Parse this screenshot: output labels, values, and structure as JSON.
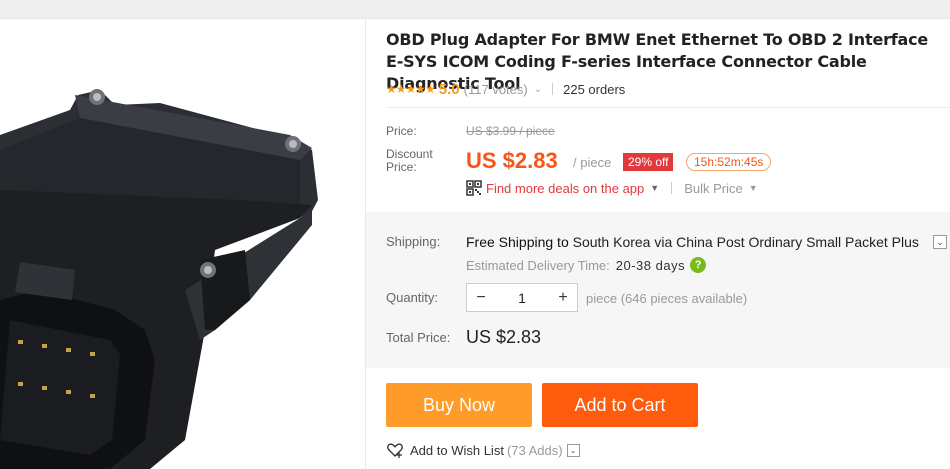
{
  "product": {
    "title": "OBD Plug Adapter For BMW Enet Ethernet To OBD 2 Interface E-SYS ICOM Coding F-series Interface Connector Cable Diagnostic Tool",
    "image_alt": "OBD connector adapter"
  },
  "rating": {
    "stars": "★★★★★",
    "value": "5.0",
    "votes": "(117 votes)",
    "orders": "225 orders"
  },
  "price": {
    "price_label": "Price:",
    "old_price": "US $3.99 / piece",
    "discount_label_line1": "Discount",
    "discount_label_line2": "Price:",
    "current": "US $2.83",
    "unit": "/ piece",
    "discount_badge": "29% off",
    "timer": "15h:52m:45s",
    "app_deals": "Find more deals on the app",
    "bulk_price": "Bulk Price"
  },
  "shipping": {
    "label": "Shipping:",
    "method_prefix": "Free Shipping to",
    "method_rest": "South Korea via China Post Ordinary Small Packet Plus",
    "delivery_label": "Estimated Delivery Time:",
    "delivery_days": "20-38 days"
  },
  "quantity": {
    "label": "Quantity:",
    "value": "1",
    "minus": "−",
    "plus": "+",
    "note": "piece (646 pieces available)"
  },
  "total": {
    "label": "Total Price:",
    "value": "US $2.83"
  },
  "actions": {
    "buy_now": "Buy Now",
    "add_to_cart": "Add to Cart"
  },
  "wishlist": {
    "label": "Add to Wish List",
    "count": "(73 Adds)"
  },
  "colors": {
    "accent": "#f5561a",
    "buy_now": "#ff9b28",
    "add_to_cart": "#ff5b0d",
    "star": "#f79b1c",
    "badge": "#e4393c",
    "help": "#78bb1c"
  }
}
